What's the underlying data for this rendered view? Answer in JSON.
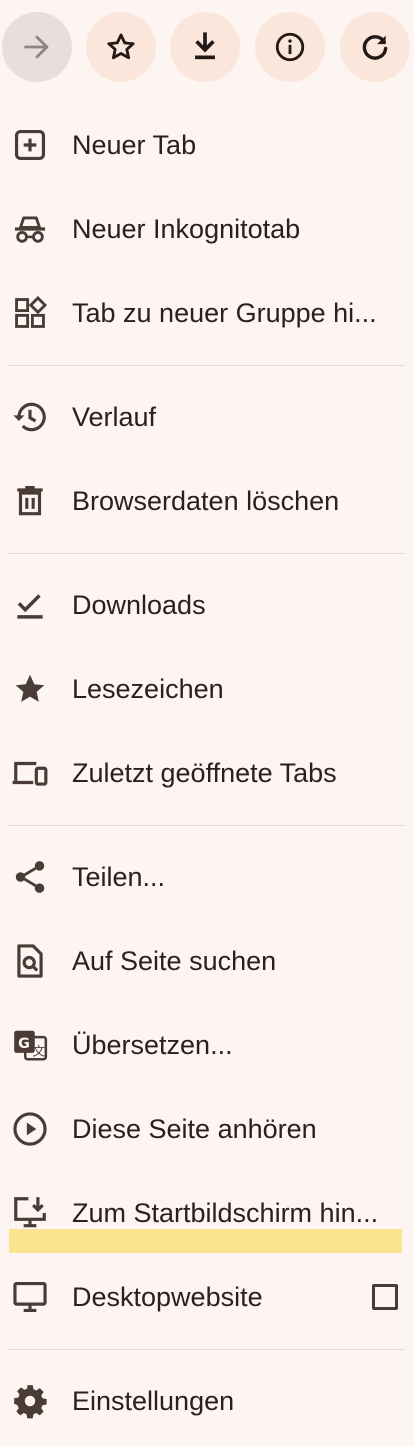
{
  "toolbar": {
    "buttons": [
      {
        "name": "forward",
        "icon": "arrow-right-icon",
        "enabled": false
      },
      {
        "name": "bookmark",
        "icon": "star-outline-icon",
        "enabled": true
      },
      {
        "name": "download",
        "icon": "download-icon",
        "enabled": true
      },
      {
        "name": "page-info",
        "icon": "info-icon",
        "enabled": true
      },
      {
        "name": "reload",
        "icon": "refresh-icon",
        "enabled": true
      }
    ]
  },
  "menu": {
    "new_tab": "Neuer Tab",
    "new_incognito_tab": "Neuer Inkognitotab",
    "add_tab_to_group": "Tab zu neuer Gruppe hi...",
    "history": "Verlauf",
    "clear_browsing_data": "Browserdaten löschen",
    "downloads": "Downloads",
    "bookmarks": "Lesezeichen",
    "recent_tabs": "Zuletzt geöffnete Tabs",
    "share": "Teilen...",
    "find_in_page": "Auf Seite suchen",
    "translate": "Übersetzen...",
    "listen_to_page": "Diese Seite anhören",
    "add_to_home_screen": "Zum Startbildschirm hin...",
    "desktop_site": "Desktopwebsite",
    "desktop_site_checked": false,
    "settings": "Einstellungen"
  },
  "colors": {
    "background": "#fdf5f2",
    "button_bg": "#fbe6dc",
    "button_disabled_bg": "#e6dfdc",
    "icon": "#4a3b36",
    "highlight": "#fbe38f"
  }
}
